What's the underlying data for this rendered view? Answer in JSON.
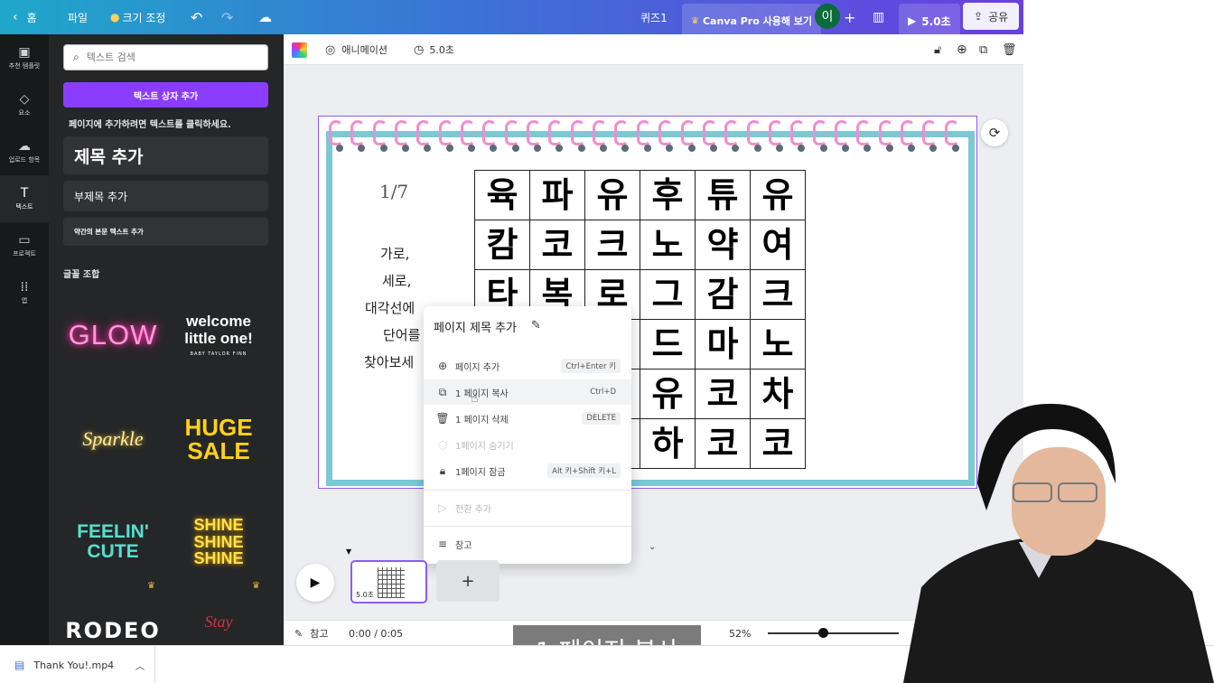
{
  "topbar": {
    "home": "홈",
    "file": "파일",
    "resize": "크기 조정",
    "doc_title": "퀴즈1",
    "pro": "Canva Pro 사용해 보기",
    "avatar": "이",
    "duration": "5.0초",
    "share": "공유"
  },
  "rail": [
    {
      "label": "추천 템플릿",
      "icon": "template-icon"
    },
    {
      "label": "요소",
      "icon": "elements-icon"
    },
    {
      "label": "업로드 항목",
      "icon": "upload-icon"
    },
    {
      "label": "텍스트",
      "icon": "text-icon"
    },
    {
      "label": "프로젝트",
      "icon": "folder-icon"
    },
    {
      "label": "앱",
      "icon": "apps-icon"
    }
  ],
  "panel": {
    "search_placeholder": "텍스트 검색",
    "add_textbox": "텍스트 상자 추가",
    "hint": "페이지에 추가하려면 텍스트를 클릭하세요.",
    "heading": "제목 추가",
    "subheading": "부제목 추가",
    "body": "약간의 본문 텍스트 추가",
    "font_combos_title": "글꼴 조합",
    "combos": [
      "GLOW",
      "welcome little one!",
      "BABY TAYLOR FINN",
      "Sparkle",
      "HUGE SALE",
      "FEELIN' CUTE",
      "SHINE SHINE SHINE",
      "RODEO",
      "Stay"
    ]
  },
  "toolbar": {
    "animation": "애니메이션",
    "duration": "5.0초"
  },
  "page": {
    "number": "1/7",
    "instructions": [
      "가로,",
      "세로,",
      "대각선에",
      "단어를",
      "찾아보세"
    ],
    "grid": [
      [
        "육",
        "파",
        "유",
        "후",
        "튜",
        "유"
      ],
      [
        "캄",
        "코",
        "크",
        "노",
        "약",
        "여"
      ],
      [
        "타",
        "복",
        "로",
        "그",
        "감",
        "크"
      ],
      [
        "",
        "",
        "",
        "드",
        "마",
        "노"
      ],
      [
        "",
        "",
        "",
        "유",
        "코",
        "차"
      ],
      [
        "",
        "",
        "",
        "하",
        "코",
        "코"
      ]
    ]
  },
  "context_menu": {
    "title": "페이지 제목 추가",
    "items": [
      {
        "label": "페이지 추가",
        "shortcut": "Ctrl+Enter 키"
      },
      {
        "label": "1 페이지 복사",
        "shortcut": "Ctrl+D"
      },
      {
        "label": "1 페이지 삭제",
        "shortcut": "DELETE"
      },
      {
        "label": "1페이지 숨기기",
        "shortcut": ""
      },
      {
        "label": "1페이지 잠금",
        "shortcut": "Alt 키+Shift 키+L"
      },
      {
        "label": "전환 추가",
        "shortcut": ""
      },
      {
        "label": "참고",
        "shortcut": ""
      }
    ]
  },
  "timeline": {
    "thumb_duration": "5.0초"
  },
  "status": {
    "notes": "참고",
    "time": "0:00 / 0:05",
    "zoom": "52%",
    "zoom_level": 0.52
  },
  "caption": "1 페이지 복사",
  "download": {
    "filename": "Thank You!.mp4"
  },
  "colors": {
    "accent": "#8b3dff",
    "frame": "#7cc8d4",
    "rings": "#f08ecf"
  }
}
